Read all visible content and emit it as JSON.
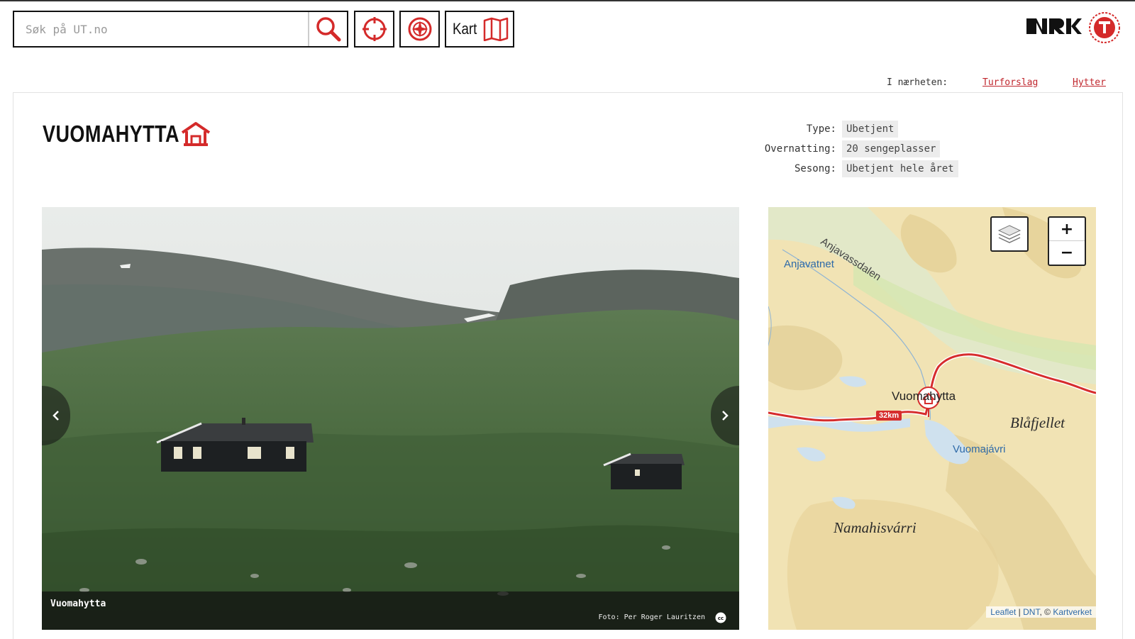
{
  "search": {
    "placeholder": "Søk på UT.no",
    "value": ""
  },
  "toolbar": {
    "map_label": "Kart"
  },
  "nearby": {
    "label": "I nærheten:",
    "links": [
      "Turforslag",
      "Hytter"
    ]
  },
  "hut": {
    "title": "VUOMAHYTTA",
    "facts": [
      {
        "label": "Type:",
        "value": "Ubetjent"
      },
      {
        "label": "Overnatting:",
        "value": "20 sengeplasser"
      },
      {
        "label": "Sesong:",
        "value": "Ubetjent hele året"
      }
    ]
  },
  "gallery": {
    "caption": "Vuomahytta",
    "credit": "Foto: Per Roger Lauritzen"
  },
  "map": {
    "labels": {
      "lake_north": "Anjavatnet",
      "valley": "Anjavassdalen",
      "hut": "Vuomahytta",
      "peak_east": "Blåfjellet",
      "lake_south": "Vuomajávri",
      "peak_south": "Namahisvárri"
    },
    "route_distance": "32km",
    "zoom_in": "+",
    "zoom_out": "−",
    "attribution": {
      "leaflet": "Leaflet",
      "sep1": " | ",
      "dnt": "DNT",
      "sep2": ", © ",
      "kartverket": "Kartverket"
    }
  },
  "colors": {
    "accent": "#c0262d",
    "route": "#d62d2d",
    "map_land": "#f1e3b4",
    "map_water": "#cfe1ee"
  }
}
